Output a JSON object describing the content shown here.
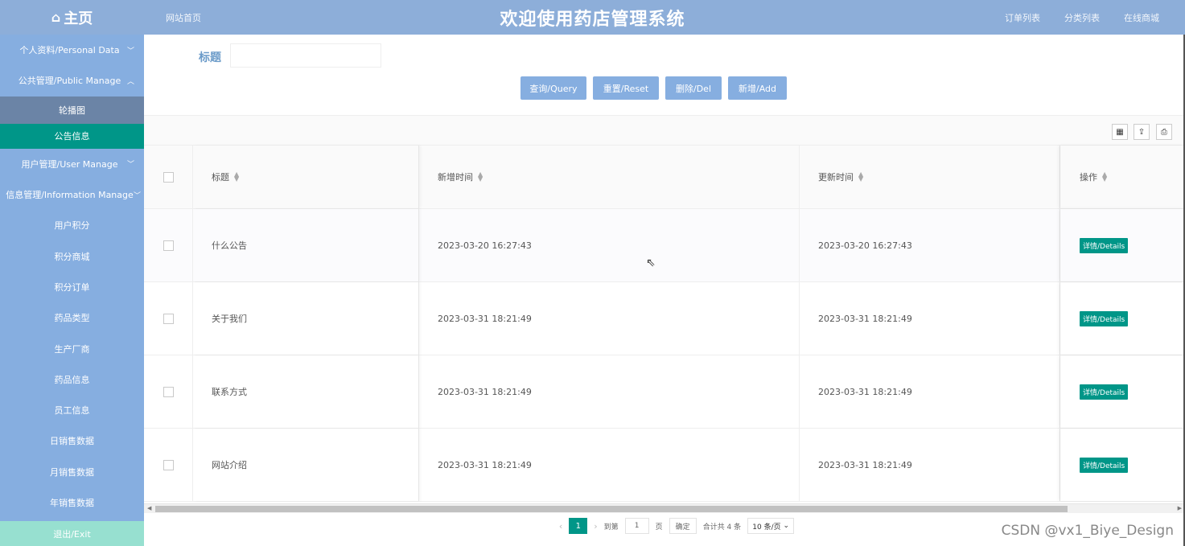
{
  "header": {
    "home_label": "主页",
    "site_home": "网站首页",
    "title": "欢迎使用药店管理系统",
    "right_links": [
      "订单列表",
      "分类列表",
      "在线商城"
    ]
  },
  "sidebar": {
    "items": [
      {
        "label": "个人资料/Personal Data",
        "type": "parent",
        "chev": "﹀"
      },
      {
        "label": "公共管理/Public Manage",
        "type": "parent",
        "chev": "︿"
      },
      {
        "label": "轮播图",
        "type": "sub-dark"
      },
      {
        "label": "公告信息",
        "type": "active"
      },
      {
        "label": "用户管理/User Manage",
        "type": "parent",
        "chev": "﹀"
      },
      {
        "label": "信息管理/Information Manage",
        "type": "parent",
        "chev": "﹀"
      },
      {
        "label": "用户积分",
        "type": "sub"
      },
      {
        "label": "积分商城",
        "type": "sub"
      },
      {
        "label": "积分订单",
        "type": "sub"
      },
      {
        "label": "药品类型",
        "type": "sub"
      },
      {
        "label": "生产厂商",
        "type": "sub"
      },
      {
        "label": "药品信息",
        "type": "sub"
      },
      {
        "label": "员工信息",
        "type": "sub"
      },
      {
        "label": "日销售数据",
        "type": "sub"
      },
      {
        "label": "月销售数据",
        "type": "sub"
      },
      {
        "label": "年销售数据",
        "type": "sub"
      }
    ],
    "exit_label": "退出/Exit"
  },
  "search": {
    "label": "标题",
    "value": "",
    "placeholder": ""
  },
  "buttons": {
    "query": "查询/Query",
    "reset": "重置/Reset",
    "delete": "删除/Del",
    "add": "新增/Add"
  },
  "table": {
    "headers": {
      "title": "标题",
      "add_time": "新增时间",
      "update_time": "更新时间",
      "action": "操作"
    },
    "rows": [
      {
        "title": "什么公告",
        "add_time": "2023-03-20 16:27:43",
        "update_time": "2023-03-20 16:27:43",
        "action": "详情/Details"
      },
      {
        "title": "关于我们",
        "add_time": "2023-03-31 18:21:49",
        "update_time": "2023-03-31 18:21:49",
        "action": "详情/Details"
      },
      {
        "title": "联系方式",
        "add_time": "2023-03-31 18:21:49",
        "update_time": "2023-03-31 18:21:49",
        "action": "详情/Details"
      },
      {
        "title": "网站介绍",
        "add_time": "2023-03-31 18:21:49",
        "update_time": "2023-03-31 18:21:49",
        "action": "详情/Details"
      }
    ]
  },
  "pager": {
    "current_page": "1",
    "goto_label": "到第",
    "goto_value": "1",
    "page_unit": "页",
    "confirm": "确定",
    "total": "合计共 4 条",
    "page_size": "10 条/页"
  },
  "watermark": "CSDN @vx1_Biye_Design",
  "colors": {
    "header_bg": "#8daed9",
    "sidebar_bg": "#86aee0",
    "active": "#009688",
    "button": "#86aee0"
  }
}
